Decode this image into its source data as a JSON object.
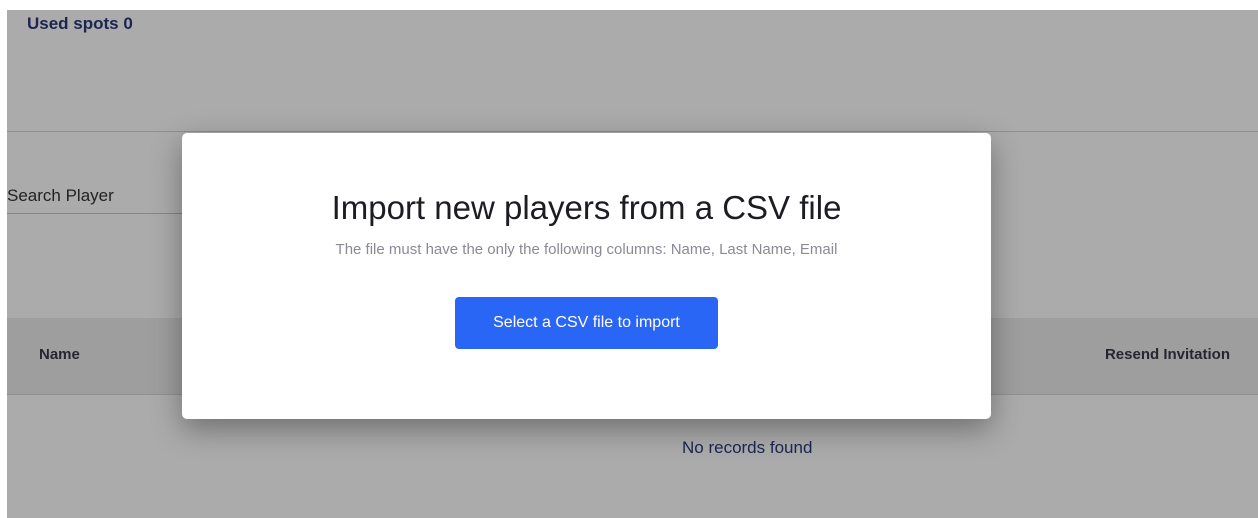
{
  "header": {
    "used_spots_label": "Used spots 0"
  },
  "search": {
    "label": "Search Player"
  },
  "table": {
    "columns": [
      "Name",
      "Resend Invitation"
    ],
    "empty_message": "No records found"
  },
  "modal": {
    "title": "Import new players from a CSV file",
    "subtitle": "The file must have the only the following columns: Name, Last Name, Email",
    "button_label": "Select a CSV file to import"
  },
  "colors": {
    "accent": "#2a66f5",
    "heading_navy": "#2a3a7a"
  }
}
